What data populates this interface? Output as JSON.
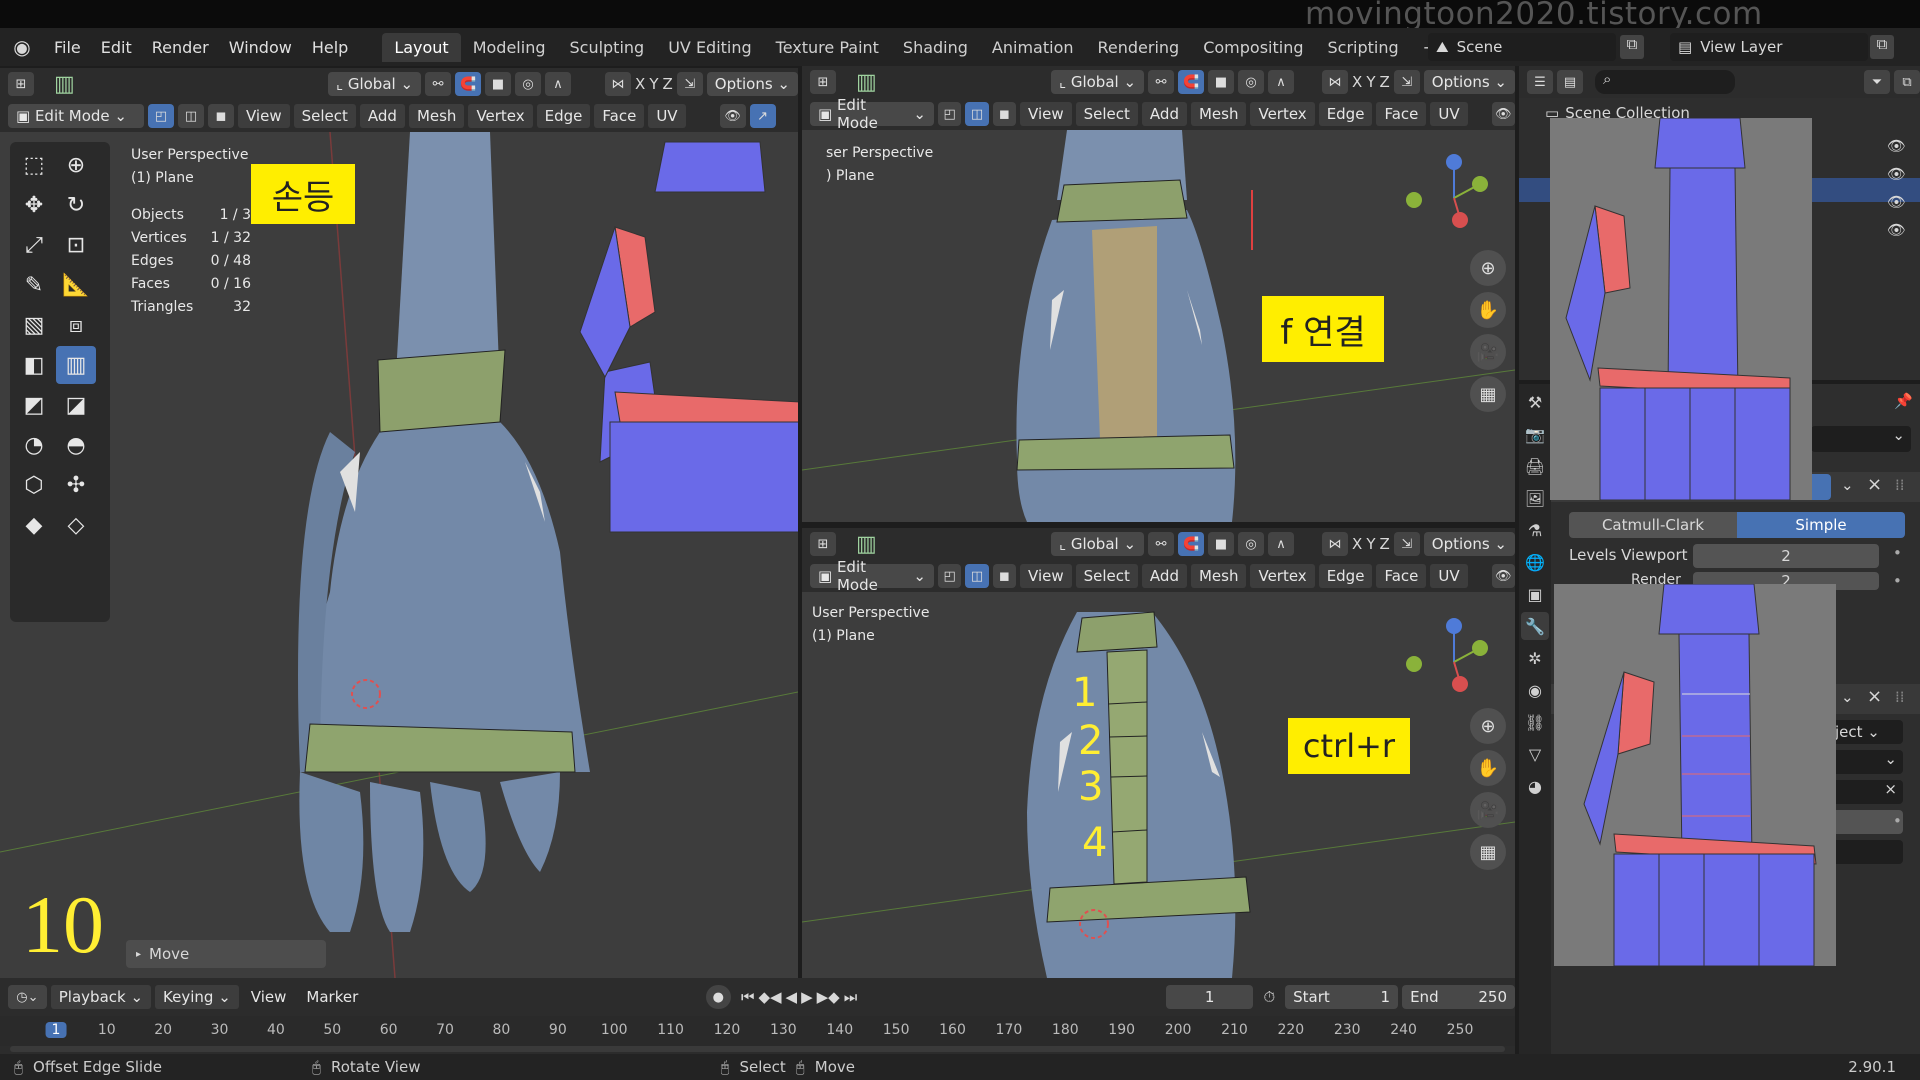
{
  "watermark": "movingtoon2020.tistory.com",
  "menu": [
    "File",
    "Edit",
    "Render",
    "Window",
    "Help"
  ],
  "workspaces": [
    "Layout",
    "Modeling",
    "Sculpting",
    "UV Editing",
    "Texture Paint",
    "Shading",
    "Animation",
    "Rendering",
    "Compositing",
    "Scripting"
  ],
  "scene": "Scene",
  "view_layer": "View Layer",
  "header": {
    "orientation": "Global",
    "options": "Options",
    "mode": "Edit Mode",
    "axes": [
      "X",
      "Y",
      "Z"
    ],
    "menus": [
      "View",
      "Select",
      "Add",
      "Mesh",
      "Vertex",
      "Edge",
      "Face",
      "UV"
    ]
  },
  "vp1": {
    "persp": "User Perspective",
    "obj": "(1) Plane",
    "stats": [
      [
        "Objects",
        "1 / 3"
      ],
      [
        "Vertices",
        "1 / 32"
      ],
      [
        "Edges",
        "0 / 48"
      ],
      [
        "Faces",
        "0 / 16"
      ],
      [
        "Triangles",
        "32"
      ]
    ],
    "label": "손등",
    "step": "10",
    "op": "Move"
  },
  "vp2": {
    "persp": "ser Perspective",
    "obj": ") Plane",
    "label": "f 연결"
  },
  "vp3": {
    "persp": "User Perspective",
    "obj": "(1) Plane",
    "label": "ctrl+r",
    "nums": [
      "1",
      "2",
      "3",
      "4"
    ]
  },
  "outliner": {
    "title": "Scene Collection"
  },
  "props": {
    "catmull": "Catmull-Clark",
    "simple": "Simple",
    "levels_label": "Levels Viewport",
    "levels_val": "2",
    "render_label": "Render",
    "render_val": "2",
    "select_trunc": "ject"
  },
  "timeline": {
    "playback": "Playback",
    "keying": "Keying",
    "view": "View",
    "marker": "Marker",
    "frame": "1",
    "start_label": "Start",
    "start": "1",
    "end_label": "End",
    "end": "250",
    "ticks": [
      "1",
      "10",
      "20",
      "30",
      "40",
      "50",
      "60",
      "70",
      "80",
      "90",
      "100",
      "110",
      "120",
      "130",
      "140",
      "150",
      "160",
      "170",
      "180",
      "190",
      "200",
      "210",
      "220",
      "230",
      "240",
      "250"
    ]
  },
  "status": {
    "a": "Offset Edge Slide",
    "b": "Rotate View",
    "c": "Select",
    "d": "Move",
    "version": "2.90.1"
  }
}
